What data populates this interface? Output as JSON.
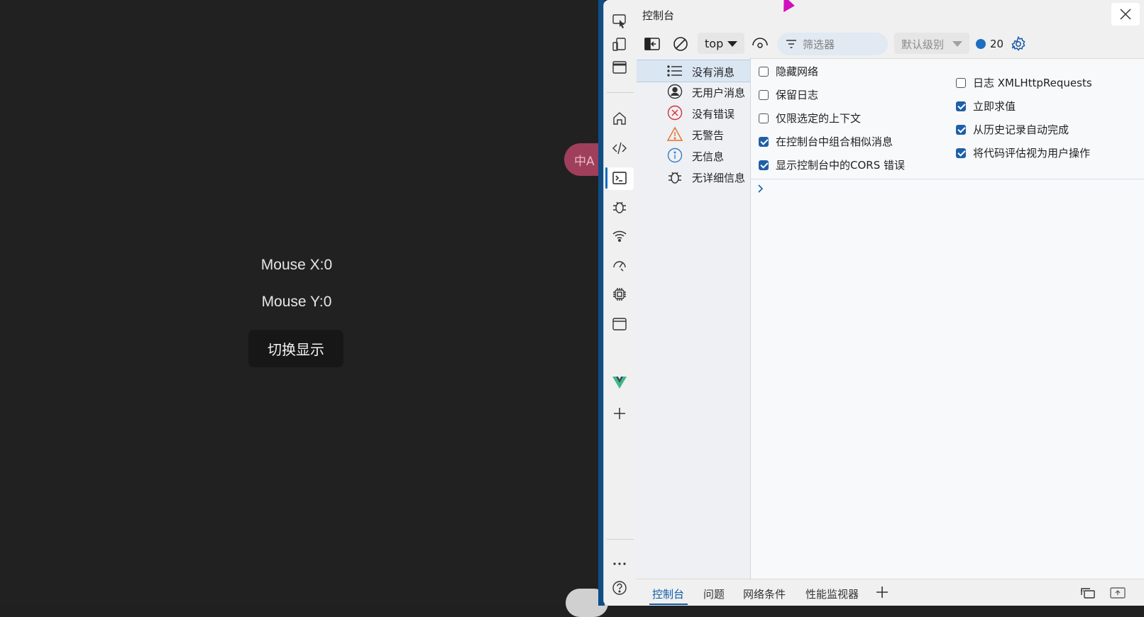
{
  "page": {
    "mouse_x": "Mouse X:0",
    "mouse_y": "Mouse Y:0",
    "toggle_label": "切换显示",
    "translate_badge": "中A"
  },
  "devtools": {
    "title": "控制台",
    "toolbar": {
      "context": "top",
      "filter_placeholder": "筛选器",
      "level": "默认级别",
      "issue_count": "20"
    },
    "sidebar": [
      {
        "label": "没有消息",
        "icon": "list-icon",
        "selected": true
      },
      {
        "label": "无用户消息",
        "icon": "user-circle-icon"
      },
      {
        "label": "没有错误",
        "icon": "error-circle-icon"
      },
      {
        "label": "无警告",
        "icon": "warning-triangle-icon"
      },
      {
        "label": "无信息",
        "icon": "info-circle-icon"
      },
      {
        "label": "无详细信息",
        "icon": "bug-icon"
      }
    ],
    "settings_left": [
      {
        "label": "隐藏网络",
        "checked": false
      },
      {
        "label": "保留日志",
        "checked": false
      },
      {
        "label": "仅限选定的上下文",
        "checked": false
      },
      {
        "label": "在控制台中组合相似消息",
        "checked": true
      },
      {
        "label": "显示控制台中的CORS 错误",
        "checked": true
      }
    ],
    "settings_right": [
      {
        "label": "日志 XMLHttpRequests",
        "checked": false
      },
      {
        "label": "立即求值",
        "checked": true
      },
      {
        "label": "从历史记录自动完成",
        "checked": true
      },
      {
        "label": "将代码评估视为用户操作",
        "checked": true
      }
    ],
    "drawer_tabs": [
      "控制台",
      "问题",
      "网络条件",
      "性能监视器"
    ],
    "colors": {
      "accent": "#0f6cbd",
      "checkbox": "#1f5fa8",
      "error": "#d13438",
      "warning": "#e3702a",
      "info": "#3a7dc9",
      "vue": "#41b883"
    }
  }
}
